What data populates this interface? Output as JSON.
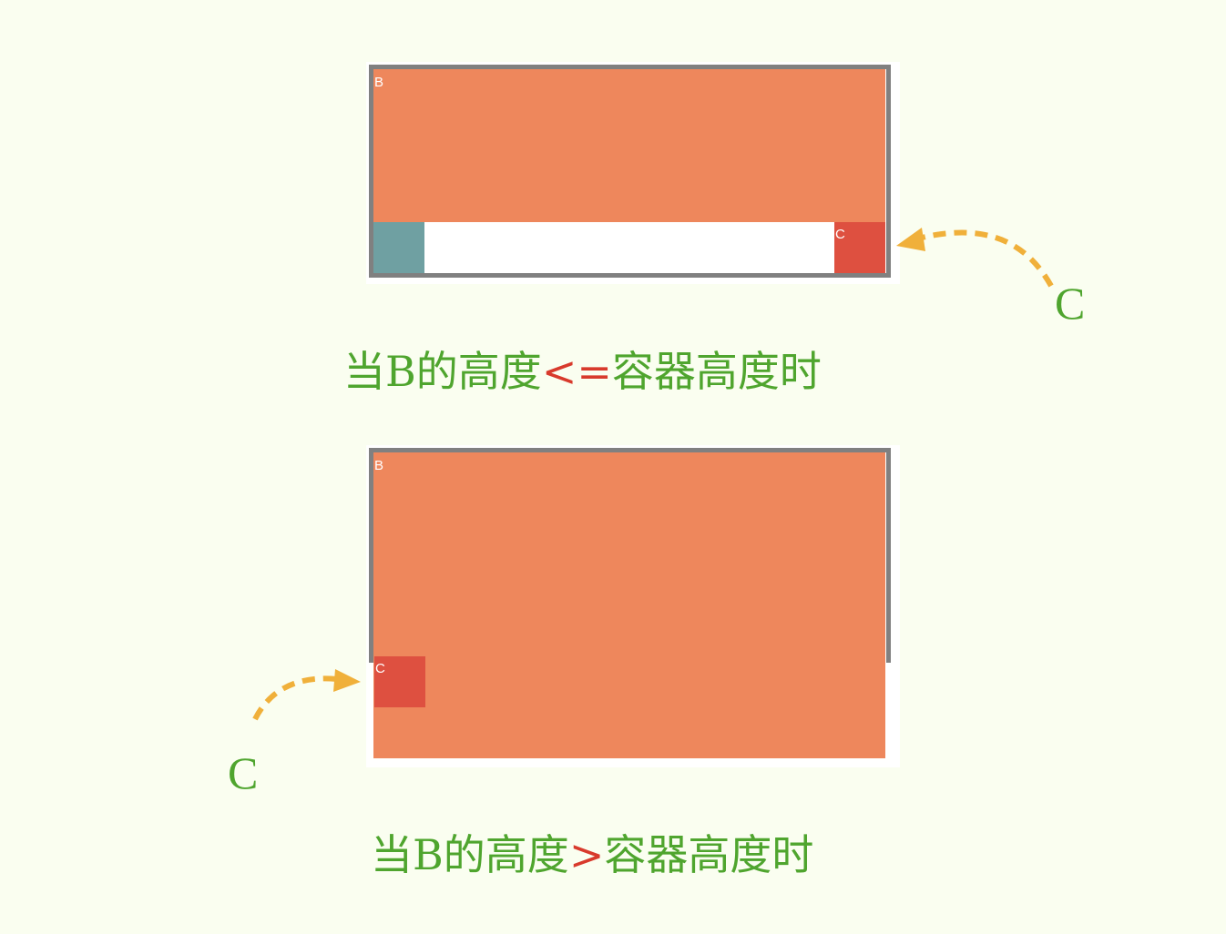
{
  "colors": {
    "background": "#fafef0",
    "container_border": "#808080",
    "block_b": "#ee875c",
    "block_c": "#de5040",
    "block_teal": "#6fa0a2",
    "caption_text": "#4fa52e",
    "caption_operator": "#d83a2c",
    "arrow": "#f0b03a"
  },
  "diagram_top": {
    "block_b_label": "B",
    "block_c_label": "C",
    "callout_label": "C",
    "caption": {
      "prefix": "当B的高度",
      "operator": "<=",
      "suffix": "容器高度时"
    }
  },
  "diagram_bottom": {
    "block_b_label": "B",
    "block_c_label": "C",
    "callout_label": "C",
    "caption": {
      "prefix": "当B的高度",
      "operator": ">",
      "suffix": "容器高度时"
    }
  }
}
